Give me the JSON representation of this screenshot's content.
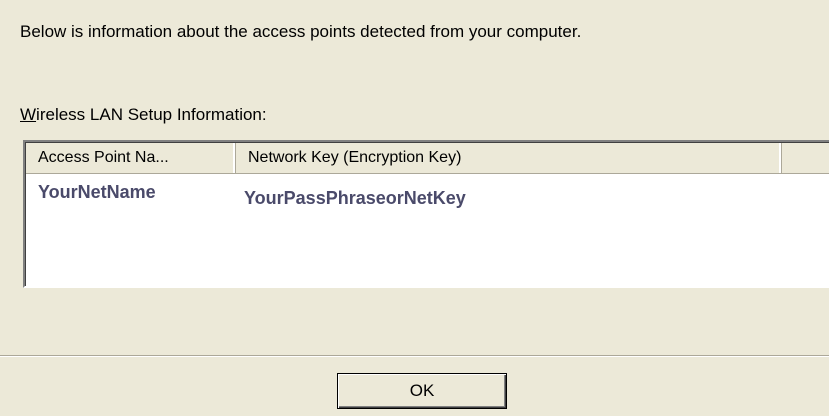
{
  "intro_text": "Below is information about the access points detected from your computer.",
  "section": {
    "label_mnemonic": "W",
    "label_rest": "ireless LAN Setup Information:"
  },
  "table": {
    "columns": [
      "Access Point Na...",
      "Network Key (Encryption Key)",
      ""
    ],
    "rows": [
      {
        "access_point_name": "YourNetName",
        "network_key": "YourPassPhraseorNetKey"
      }
    ]
  },
  "buttons": {
    "ok_label": "OK"
  },
  "colors": {
    "dialog_background": "#ECE9D8",
    "list_background": "#FFFFFF",
    "row_text": "#4A4A6A"
  }
}
